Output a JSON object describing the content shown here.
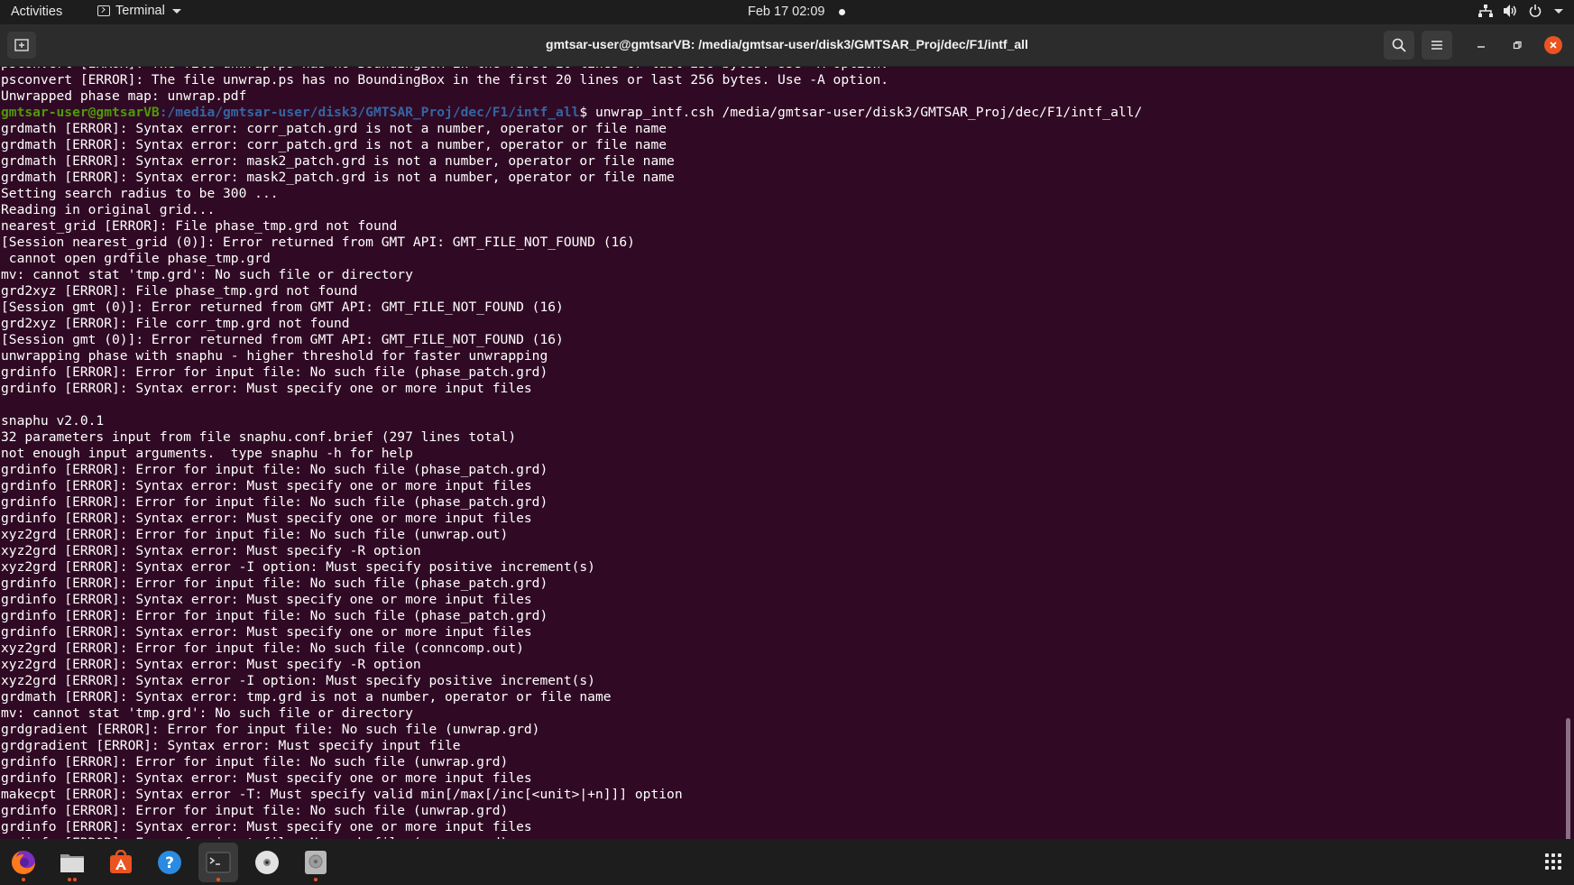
{
  "topbar": {
    "activities": "Activities",
    "app_name": "Terminal",
    "datetime": "Feb 17  02:09"
  },
  "window": {
    "title": "gmtsar-user@gmtsarVB: /media/gmtsar-user/disk3/GMTSAR_Proj/dec/F1/intf_all"
  },
  "terminal": {
    "lines_before_prompt": [
      "psconvert [ERROR]: The file unwrap.ps has no BoundingBox in the first 20 lines or last 256 bytes. Use -A option.",
      "psconvert [ERROR]: The file unwrap.ps has no BoundingBox in the first 20 lines or last 256 bytes. Use -A option.",
      "Unwrapped phase map: unwrap.pdf"
    ],
    "prompt_user": "gmtsar-user@gmtsarVB",
    "prompt_path": ":/media/gmtsar-user/disk3/GMTSAR_Proj/dec/F1/intf_all",
    "prompt_command": "$ unwrap_intf.csh /media/gmtsar-user/disk3/GMTSAR_Proj/dec/F1/intf_all/",
    "lines_after_prompt": [
      "grdmath [ERROR]: Syntax error: corr_patch.grd is not a number, operator or file name",
      "grdmath [ERROR]: Syntax error: corr_patch.grd is not a number, operator or file name",
      "grdmath [ERROR]: Syntax error: mask2_patch.grd is not a number, operator or file name",
      "grdmath [ERROR]: Syntax error: mask2_patch.grd is not a number, operator or file name",
      "Setting search radius to be 300 ...",
      "Reading in original grid...",
      "nearest_grid [ERROR]: File phase_tmp.grd not found",
      "[Session nearest_grid (0)]: Error returned from GMT API: GMT_FILE_NOT_FOUND (16)",
      " cannot open grdfile phase_tmp.grd",
      "mv: cannot stat 'tmp.grd': No such file or directory",
      "grd2xyz [ERROR]: File phase_tmp.grd not found",
      "[Session gmt (0)]: Error returned from GMT API: GMT_FILE_NOT_FOUND (16)",
      "grd2xyz [ERROR]: File corr_tmp.grd not found",
      "[Session gmt (0)]: Error returned from GMT API: GMT_FILE_NOT_FOUND (16)",
      "unwrapping phase with snaphu - higher threshold for faster unwrapping",
      "grdinfo [ERROR]: Error for input file: No such file (phase_patch.grd)",
      "grdinfo [ERROR]: Syntax error: Must specify one or more input files",
      "",
      "snaphu v2.0.1",
      "32 parameters input from file snaphu.conf.brief (297 lines total)",
      "not enough input arguments.  type snaphu -h for help",
      "grdinfo [ERROR]: Error for input file: No such file (phase_patch.grd)",
      "grdinfo [ERROR]: Syntax error: Must specify one or more input files",
      "grdinfo [ERROR]: Error for input file: No such file (phase_patch.grd)",
      "grdinfo [ERROR]: Syntax error: Must specify one or more input files",
      "xyz2grd [ERROR]: Error for input file: No such file (unwrap.out)",
      "xyz2grd [ERROR]: Syntax error: Must specify -R option",
      "xyz2grd [ERROR]: Syntax error -I option: Must specify positive increment(s)",
      "grdinfo [ERROR]: Error for input file: No such file (phase_patch.grd)",
      "grdinfo [ERROR]: Syntax error: Must specify one or more input files",
      "grdinfo [ERROR]: Error for input file: No such file (phase_patch.grd)",
      "grdinfo [ERROR]: Syntax error: Must specify one or more input files",
      "xyz2grd [ERROR]: Error for input file: No such file (conncomp.out)",
      "xyz2grd [ERROR]: Syntax error: Must specify -R option",
      "xyz2grd [ERROR]: Syntax error -I option: Must specify positive increment(s)",
      "grdmath [ERROR]: Syntax error: tmp.grd is not a number, operator or file name",
      "mv: cannot stat 'tmp.grd': No such file or directory",
      "grdgradient [ERROR]: Error for input file: No such file (unwrap.grd)",
      "grdgradient [ERROR]: Syntax error: Must specify input file",
      "grdinfo [ERROR]: Error for input file: No such file (unwrap.grd)",
      "grdinfo [ERROR]: Syntax error: Must specify one or more input files",
      "makecpt [ERROR]: Syntax error -T: Must specify valid min[/max[/inc[<unit>|+n]]] option",
      "grdinfo [ERROR]: Error for input file: No such file (unwrap.grd)",
      "grdinfo [ERROR]: Syntax error: Must specify one or more input files",
      "grdinfo [ERROR]: Error for input file: No such file (unwrap.grd)"
    ]
  },
  "dock": {
    "items": [
      {
        "name": "firefox-icon",
        "running": true,
        "active": false
      },
      {
        "name": "files-icon",
        "running": true,
        "active": false
      },
      {
        "name": "software-center-icon",
        "running": false,
        "active": false
      },
      {
        "name": "help-icon",
        "running": false,
        "active": false
      },
      {
        "name": "terminal-icon",
        "running": true,
        "active": true
      },
      {
        "name": "disc-icon",
        "running": false,
        "active": false
      },
      {
        "name": "drive-icon",
        "running": true,
        "active": false
      }
    ]
  },
  "colors": {
    "terminal_bg": "#300a24",
    "prompt_user": "#4e9a06",
    "prompt_path": "#3465a4",
    "accent": "#e95420"
  }
}
